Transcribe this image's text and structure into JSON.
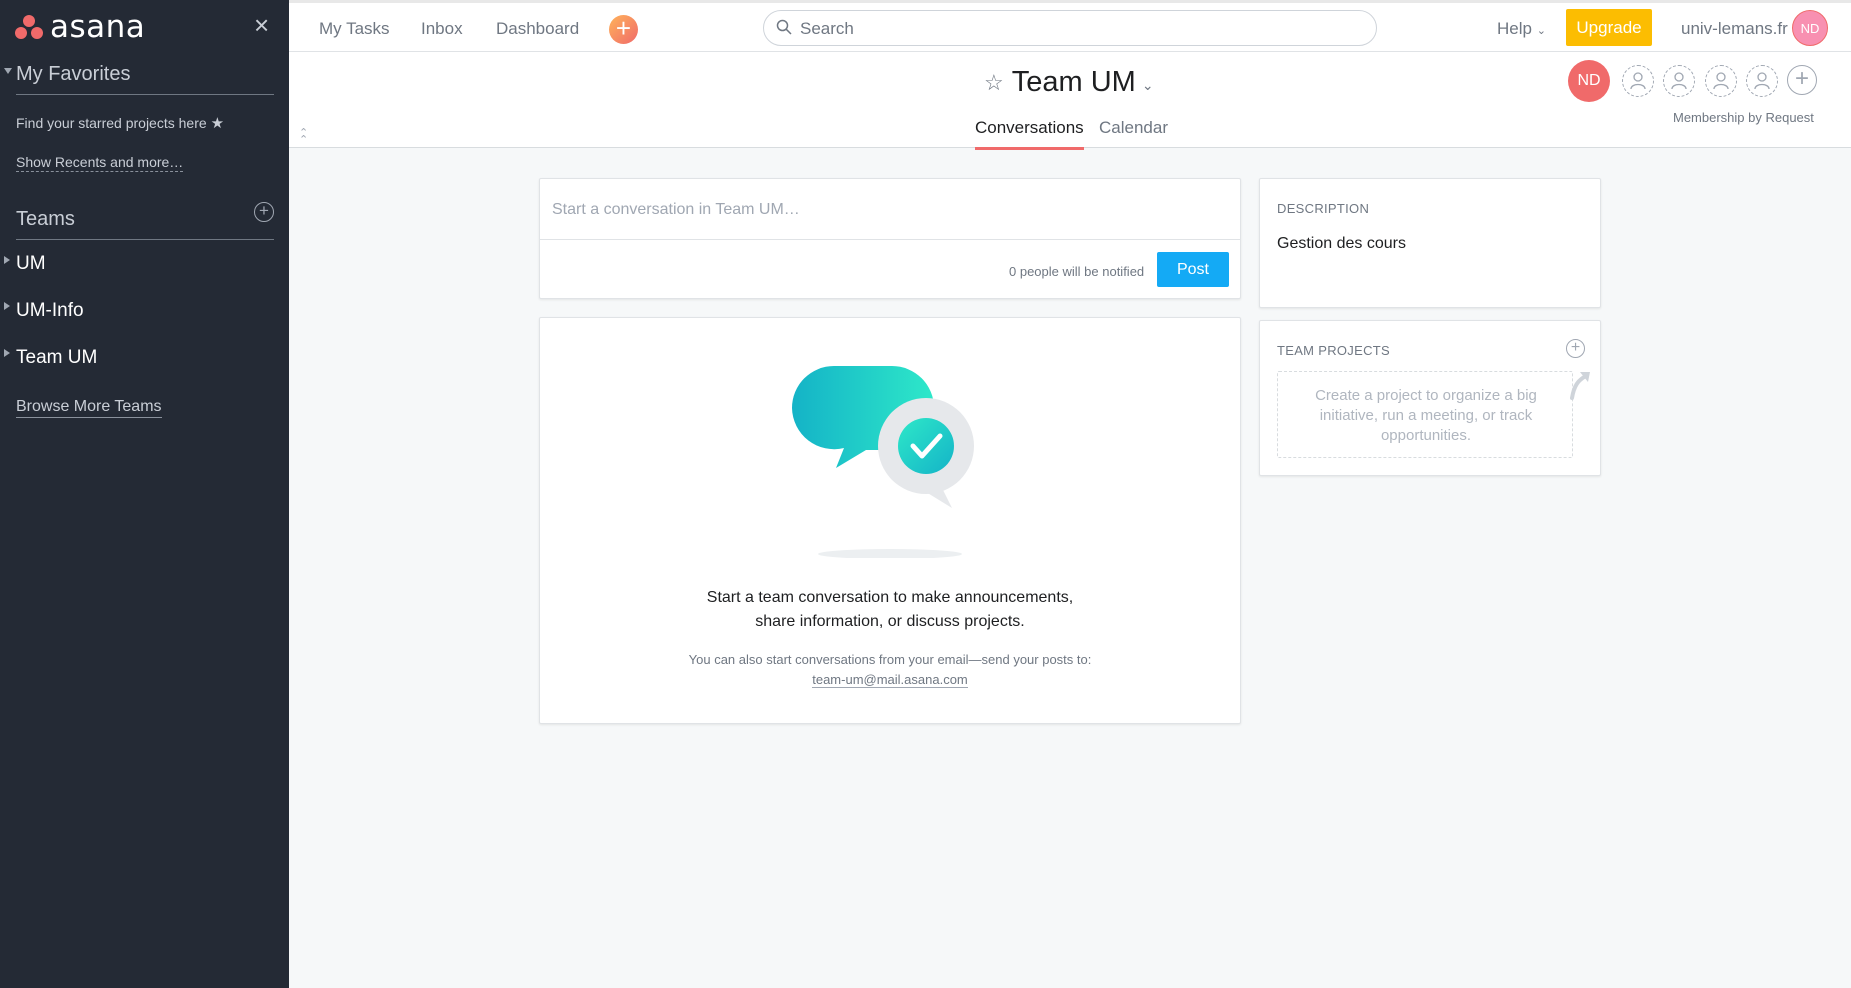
{
  "sidebar": {
    "logo_text": "asana",
    "close_glyph": "×",
    "favorites_title": "My Favorites",
    "favorites_hint": "Find your starred projects here",
    "show_recents": "Show Recents and more…",
    "teams_title": "Teams",
    "teams": [
      {
        "label": "UM"
      },
      {
        "label": "UM-Info"
      },
      {
        "label": "Team UM"
      }
    ],
    "browse_more": "Browse More Teams"
  },
  "topbar": {
    "nav": [
      "My Tasks",
      "Inbox",
      "Dashboard"
    ],
    "search_placeholder": "Search",
    "help": "Help",
    "upgrade": "Upgrade",
    "domain": "univ-lemans.fr",
    "avatar_initials": "ND"
  },
  "header": {
    "title": "Team UM",
    "tabs": [
      "Conversations",
      "Calendar"
    ],
    "member_initials": "ND",
    "membership": "Membership by Request"
  },
  "composer": {
    "placeholder": "Start a conversation in Team UM…",
    "notified": "0 people will be notified",
    "post": "Post"
  },
  "empty_state": {
    "line1": "Start a team conversation to make announcements,",
    "line2": "share information, or discuss projects.",
    "email_hint": "You can also start conversations from your email—send your posts to:",
    "email": "team-um@mail.asana.com"
  },
  "description": {
    "label": "DESCRIPTION",
    "text": "Gestion des cours"
  },
  "team_projects": {
    "label": "TEAM PROJECTS",
    "empty_text": "Create a project to organize a big initiative, run a meeting, or track opportunities."
  },
  "colors": {
    "sidebar_bg": "#242a35",
    "accent_coral": "#f06a6a",
    "upgrade_yellow": "#fcbd01",
    "post_blue": "#14aaf5",
    "teal": "#1cd1c4"
  }
}
